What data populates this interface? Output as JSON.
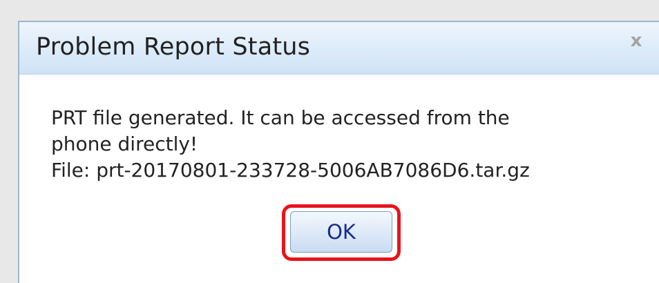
{
  "dialog": {
    "title": "Problem Report Status",
    "close_glyph": "x",
    "message_line1": "PRT file generated. It can be accessed from the",
    "message_line2": "phone directly!",
    "message_line3": "File: prt-20170801-233728-5006AB7086D6.tar.gz",
    "ok_label": "OK"
  },
  "colors": {
    "highlight": "#e8131b",
    "titlebar": "#dcebf9",
    "ok_text": "#1a2a8a"
  }
}
